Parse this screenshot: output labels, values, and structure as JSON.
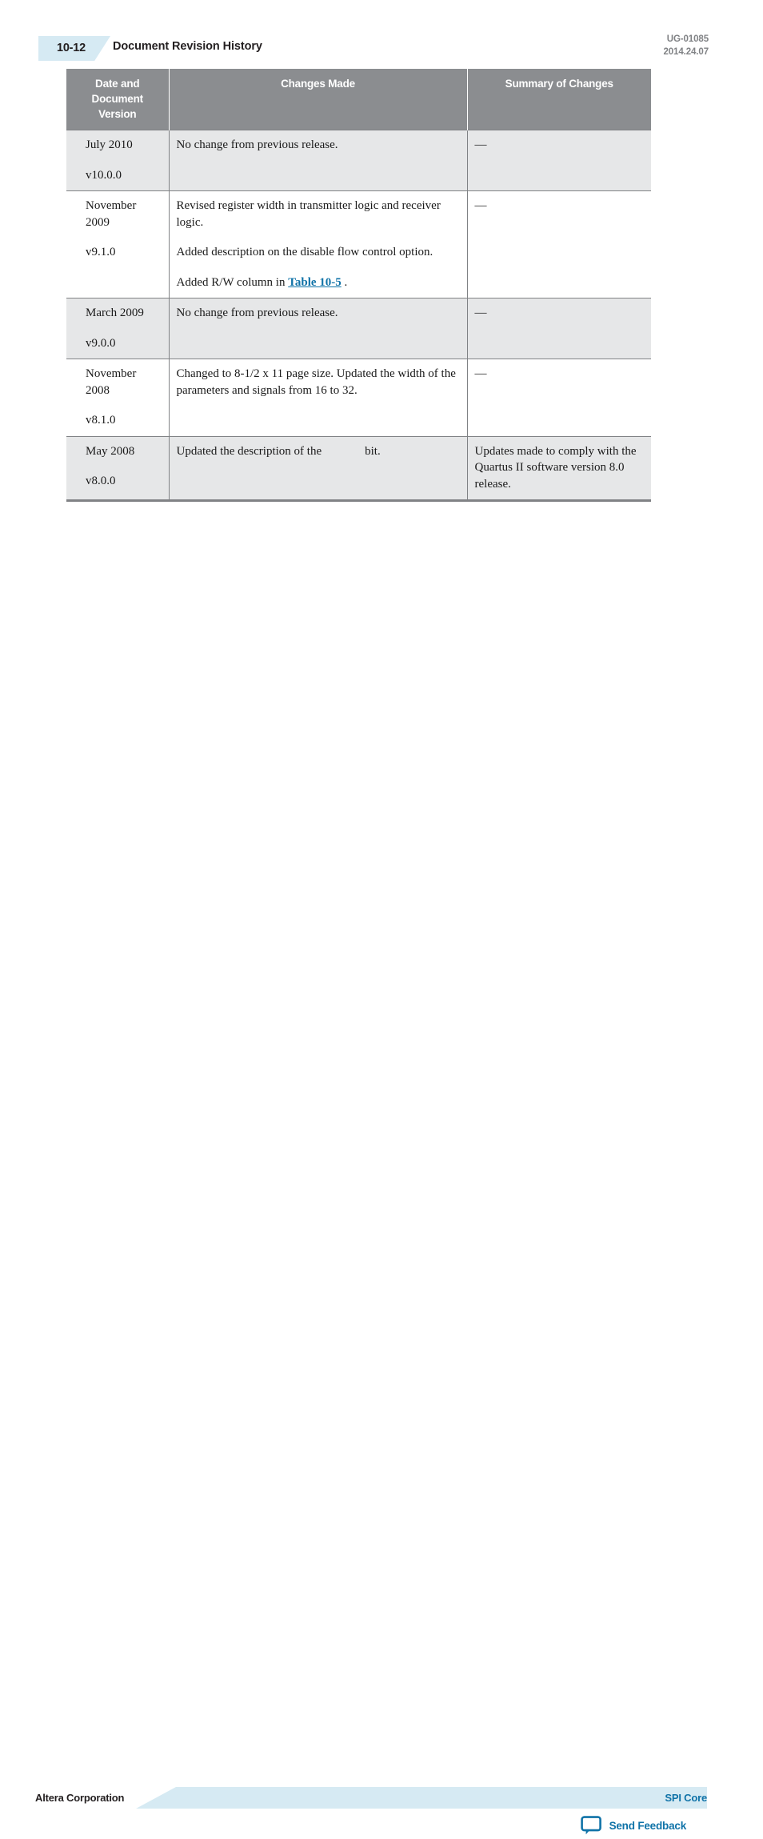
{
  "header": {
    "page_number": "10-12",
    "title": "Document Revision History",
    "doc_id": "UG-01085",
    "doc_date": "2014.24.07"
  },
  "table": {
    "columns": [
      "Date and Document Version",
      "Changes Made",
      "Summary of Changes"
    ],
    "column_headers": {
      "date_line1": "Date and",
      "date_line2": "Document",
      "date_line3": "Version",
      "changes": "Changes Made",
      "summary": "Summary of Changes"
    },
    "rows": [
      {
        "date": "July 2010",
        "version": "v10.0.0",
        "changes": [
          "No change from previous release."
        ],
        "summary": "—",
        "shaded": true
      },
      {
        "date": "November 2009",
        "version": "v9.1.0",
        "changes": [
          "Revised register width in transmitter logic and receiver logic.",
          "Added description on the disable flow control option.",
          "Added R/W column in "
        ],
        "xref": "Table 10-5",
        "xref_suffix": " .",
        "summary": "—",
        "shaded": false
      },
      {
        "date": "March 2009",
        "version": "v9.0.0",
        "changes": [
          "No change from previous release."
        ],
        "summary": "—",
        "shaded": true
      },
      {
        "date": "November 2008",
        "version": "v8.1.0",
        "changes": [
          "Changed to 8-1/2 x 11 page size. Updated the width of the parameters and signals from 16 to 32."
        ],
        "summary": "—",
        "shaded": false
      },
      {
        "date": "May 2008",
        "version": "v8.0.0",
        "changes_prefix": "Updated the description of the",
        "changes_suffix": "bit.",
        "summary": "Updates made to comply with the Quartus II software version 8.0 release.",
        "shaded": true
      }
    ]
  },
  "footer": {
    "company": "Altera Corporation",
    "doc_name": "SPI Core",
    "feedback_label": "Send Feedback",
    "feedback_icon": "speech-bubble-icon"
  },
  "colors": {
    "accent_blue": "#1073a8",
    "tab_blue": "#d6eaf3",
    "header_gray": "#8b8d90",
    "row_gray": "#e6e7e8",
    "border_gray": "#808285"
  }
}
